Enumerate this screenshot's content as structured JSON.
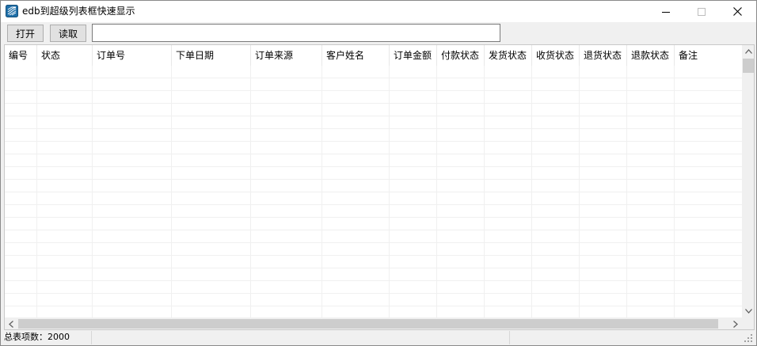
{
  "window": {
    "title": "edb到超级列表框快速显示",
    "controls": {
      "minimize": "minimize-icon",
      "maximize": "maximize-icon",
      "close": "close-icon"
    }
  },
  "toolbar": {
    "open_label": "打开",
    "read_label": "读取",
    "path_value": ""
  },
  "list": {
    "columns": [
      "编号",
      "状态",
      "订单号",
      "下单日期",
      "订单来源",
      "客户姓名",
      "订单金额",
      "付款状态",
      "发货状态",
      "收货状态",
      "退货状态",
      "退款状态",
      "备注"
    ],
    "rows": []
  },
  "status": {
    "total": "总表项数：2000",
    "pane2": "",
    "pane3": ""
  },
  "colors": {
    "window_bg": "#f0f0f0",
    "list_bg": "#ffffff",
    "grid_line": "#f0f0f0",
    "scroll_thumb": "#cdcdcd",
    "app_icon": "#1f6fa8"
  }
}
